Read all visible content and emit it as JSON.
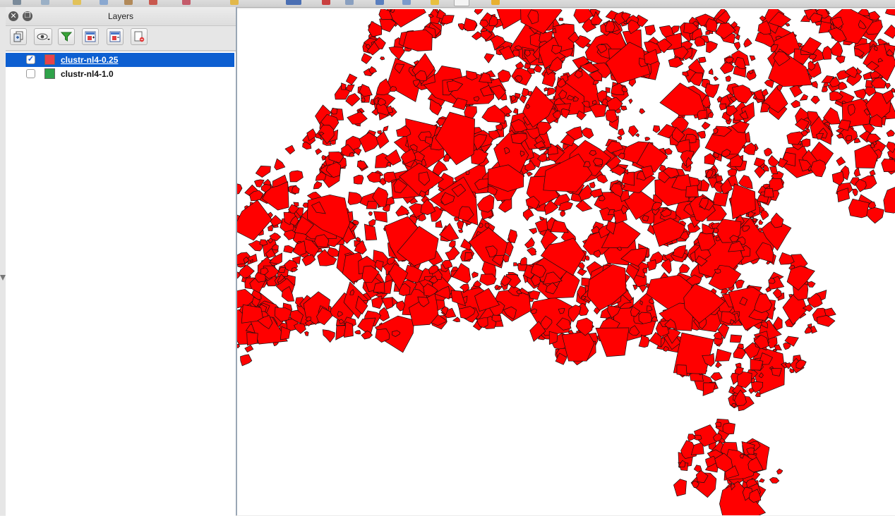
{
  "panel": {
    "title": "Layers"
  },
  "layers": [
    {
      "name": "clustr-nl4-0.25",
      "visible": true,
      "selected": true,
      "swatch_color": "#e8434a"
    },
    {
      "name": "clustr-nl4-1.0",
      "visible": false,
      "selected": false,
      "swatch_color": "#2fa24a"
    }
  ],
  "toolbar_icons": [
    "add-group-icon",
    "manage-visibility-icon",
    "filter-legend-icon",
    "expand-all-icon",
    "collapse-all-icon",
    "remove-layer-icon"
  ],
  "map": {
    "fill_color": "#ff0000",
    "stroke_color": "#111111",
    "background": "#ffffff"
  }
}
